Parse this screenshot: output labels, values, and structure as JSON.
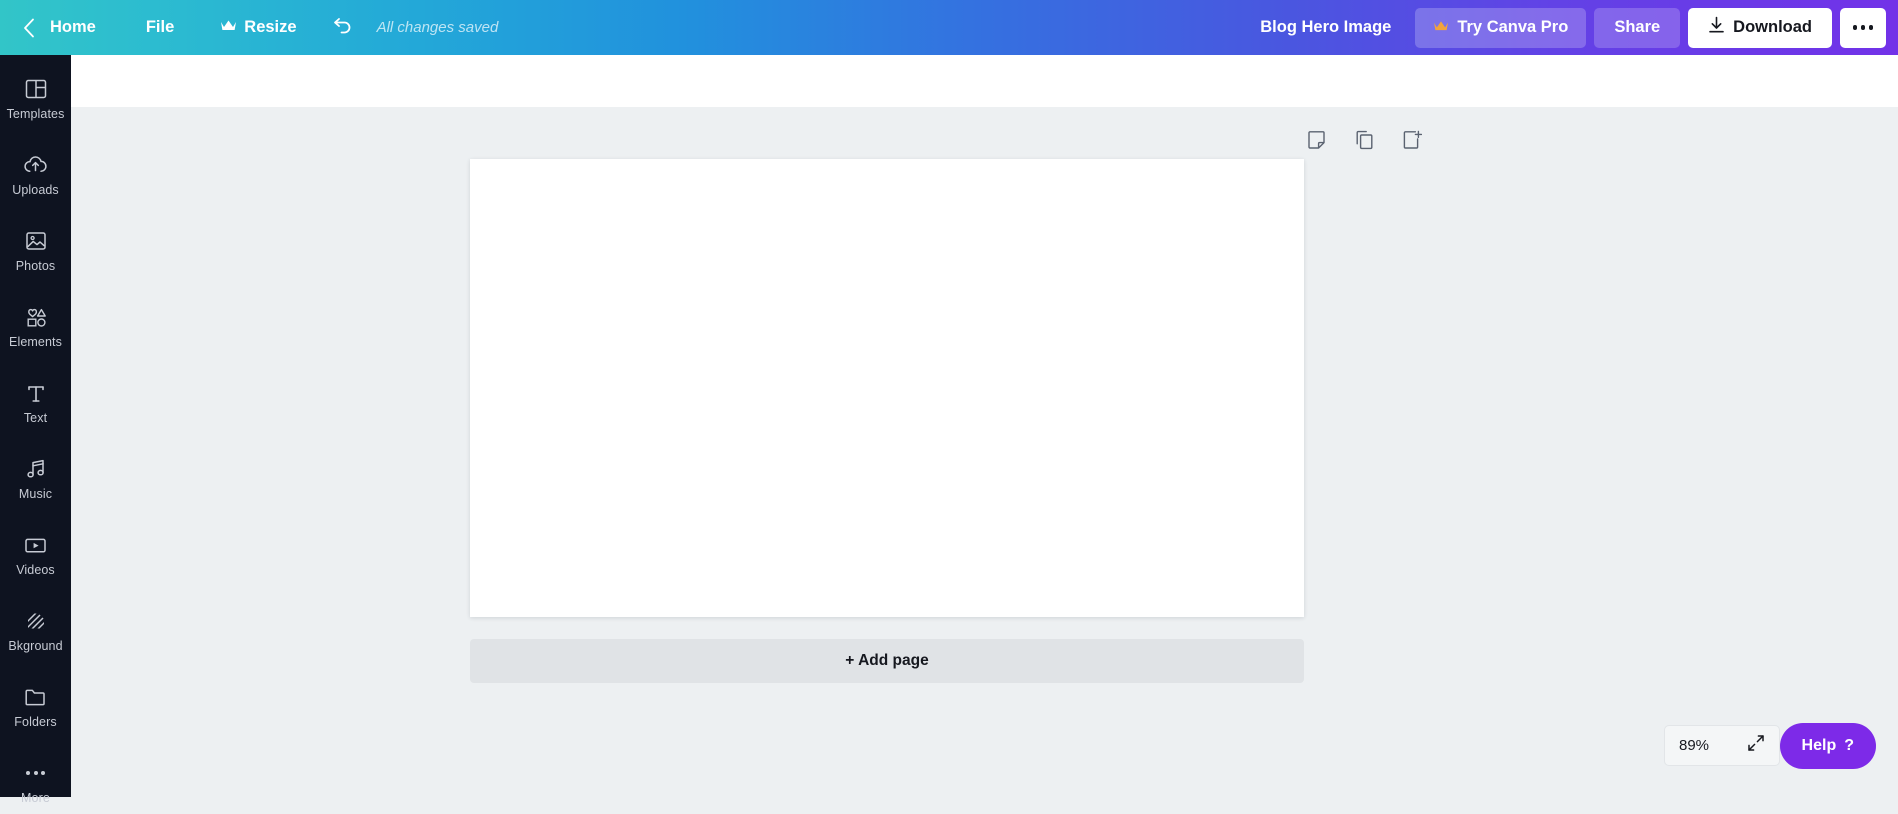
{
  "topbar": {
    "back_icon": "chevron-left-icon",
    "home_label": "Home",
    "file_label": "File",
    "resize_label": "Resize",
    "resize_icon": "crown-icon",
    "undo_icon": "undo-icon",
    "save_status": "All changes saved",
    "doc_title": "Blog Hero Image",
    "pro_label": "Try Canva Pro",
    "pro_icon": "crown-icon",
    "share_label": "Share",
    "download_label": "Download",
    "download_icon": "download-icon",
    "more_icon": "ellipsis-icon"
  },
  "sidebar": {
    "items": [
      {
        "label": "Templates",
        "icon": "templates-icon"
      },
      {
        "label": "Uploads",
        "icon": "upload-cloud-icon"
      },
      {
        "label": "Photos",
        "icon": "image-icon"
      },
      {
        "label": "Elements",
        "icon": "shapes-icon"
      },
      {
        "label": "Text",
        "icon": "text-icon"
      },
      {
        "label": "Music",
        "icon": "music-note-icon"
      },
      {
        "label": "Videos",
        "icon": "video-icon"
      },
      {
        "label": "Bkground",
        "icon": "background-hatch-icon"
      },
      {
        "label": "Folders",
        "icon": "folder-icon"
      },
      {
        "label": "More",
        "icon": "ellipsis-icon"
      }
    ]
  },
  "canvas": {
    "tools": [
      {
        "name": "notes-icon"
      },
      {
        "name": "duplicate-page-icon"
      },
      {
        "name": "add-page-icon"
      }
    ],
    "add_page_label": "+ Add page"
  },
  "footer": {
    "zoom_level": "89%",
    "fit_icon": "expand-diagonal-icon",
    "help_label": "Help",
    "help_mark": "?"
  },
  "colors": {
    "gradient_start": "#32c5c8",
    "gradient_mid": "#3570e0",
    "gradient_end": "#7232e8",
    "sidebar_bg": "#0e1320",
    "canvas_bg": "#edf0f2",
    "help_purple": "#7d2ae8",
    "crown_gold": "#f2a33c"
  }
}
